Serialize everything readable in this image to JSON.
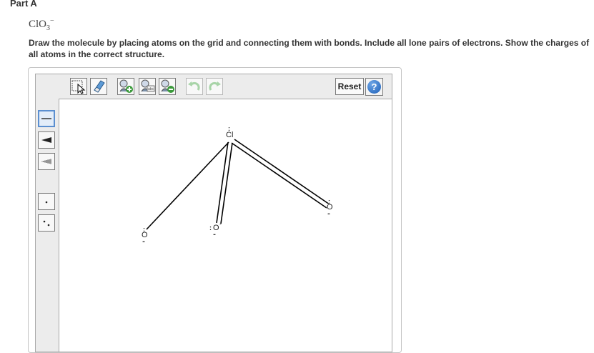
{
  "part": {
    "title": "Part A"
  },
  "formula": {
    "base": "ClO",
    "subscript": "3",
    "superscript": "−"
  },
  "instructions": "Draw the molecule by placing atoms on the grid and connecting them with bonds. Include all lone pairs of electrons. Show the charges of all atoms in the correct structure.",
  "toolbar": {
    "tools": [
      {
        "name": "select-tool",
        "icon": "select-arrow-icon"
      },
      {
        "name": "erase-tool",
        "icon": "eraser-icon"
      },
      {
        "name": "add-charge-tool",
        "icon": "atom-plus-icon"
      },
      {
        "name": "atom-label-tool",
        "icon": "atom-label-icon"
      },
      {
        "name": "remove-charge-tool",
        "icon": "atom-minus-icon"
      },
      {
        "name": "undo",
        "icon": "undo-icon"
      },
      {
        "name": "redo",
        "icon": "redo-icon"
      }
    ],
    "reset_label": "Reset",
    "help_label": "?"
  },
  "sidebar": {
    "tools": [
      {
        "name": "single-bond-tool",
        "icon": "single-bond-icon",
        "selected": true
      },
      {
        "name": "wedge-bond-tool",
        "icon": "wedge-bond-icon",
        "selected": false
      },
      {
        "name": "hash-bond-tool",
        "icon": "hash-bond-icon",
        "selected": false
      },
      {
        "name": "radical-tool",
        "icon": "single-dot-icon",
        "selected": false
      },
      {
        "name": "lone-pair-tool",
        "icon": "lone-pair-icon",
        "selected": false
      }
    ]
  },
  "molecule": {
    "atoms": [
      {
        "id": "cl",
        "symbol": "Cl",
        "lone_pair_top": ":",
        "charge": ""
      },
      {
        "id": "o1",
        "symbol": "O",
        "lone_pair_top": ":",
        "lone_pair_bottom": "..",
        "charge": ""
      },
      {
        "id": "o2",
        "symbol": "O",
        "lone_pair_left": ":",
        "lone_pair_bottom": "..",
        "charge": "-"
      },
      {
        "id": "o3",
        "symbol": "O",
        "lone_pair_top": ":",
        "lone_pair_bottom": "..",
        "charge": ""
      }
    ],
    "bonds": [
      {
        "from": "cl",
        "to": "o1",
        "order": 1
      },
      {
        "from": "cl",
        "to": "o2",
        "order": 2
      },
      {
        "from": "cl",
        "to": "o3",
        "order": 2
      }
    ]
  }
}
